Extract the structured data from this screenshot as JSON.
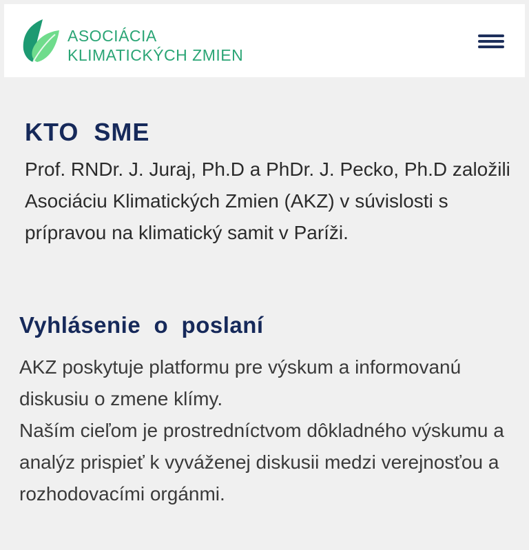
{
  "header": {
    "brand_line1": "ASOCIÁCIA",
    "brand_line2": "KLIMATICKÝCH ZMIEN",
    "logo_icon": "leaf-logo-icon",
    "menu_icon": "hamburger-menu-icon"
  },
  "about": {
    "title": "KTO  SME",
    "text": "Prof. RNDr. J. Juraj, Ph.D a PhDr. J. Pecko, Ph.D založili Asociáciu Klimatických Zmien (AKZ) v súvislosti s prípravou na klimatický samit v Paríži."
  },
  "mission": {
    "title": "Vyhlásenie  o  poslaní",
    "text1": "AKZ poskytuje platformu pre výskum a informovanú diskusiu o zmene klímy.",
    "text2": "Naším cieľom je prostredníctvom dôkladného výskumu a analýz prispieť k vyváženej diskusii medzi verejnosťou a rozhodovacími orgánmi."
  },
  "colors": {
    "brand_green": "#2aa575",
    "heading_navy": "#16295a",
    "background": "#f0f0f0"
  }
}
